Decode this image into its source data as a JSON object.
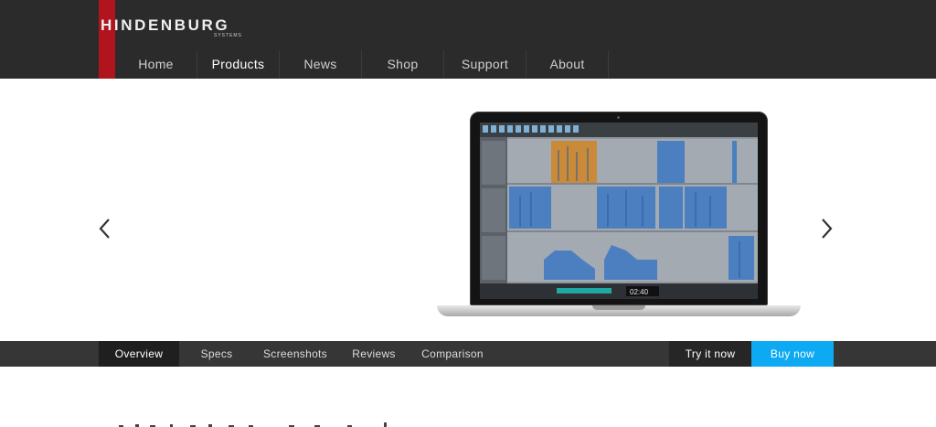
{
  "brand": {
    "logo_text": "HINDENBURG",
    "logo_sub": "SYSTEMS",
    "accent_red": "#b0141d",
    "accent_blue": "#0da9f2"
  },
  "nav": {
    "items": [
      {
        "label": "Home"
      },
      {
        "label": "Products"
      },
      {
        "label": "News"
      },
      {
        "label": "Shop"
      },
      {
        "label": "Support"
      },
      {
        "label": "About"
      }
    ],
    "active": "Products"
  },
  "hero": {
    "prev_icon": "chevron-left-icon",
    "next_icon": "chevron-right-icon",
    "laptop_time": "02:40"
  },
  "subnav": {
    "items": [
      {
        "label": "Overview"
      },
      {
        "label": "Specs"
      },
      {
        "label": "Screenshots"
      },
      {
        "label": "Reviews"
      },
      {
        "label": "Comparison"
      }
    ],
    "active": "Overview",
    "try_label": "Try it now",
    "buy_label": "Buy now"
  }
}
